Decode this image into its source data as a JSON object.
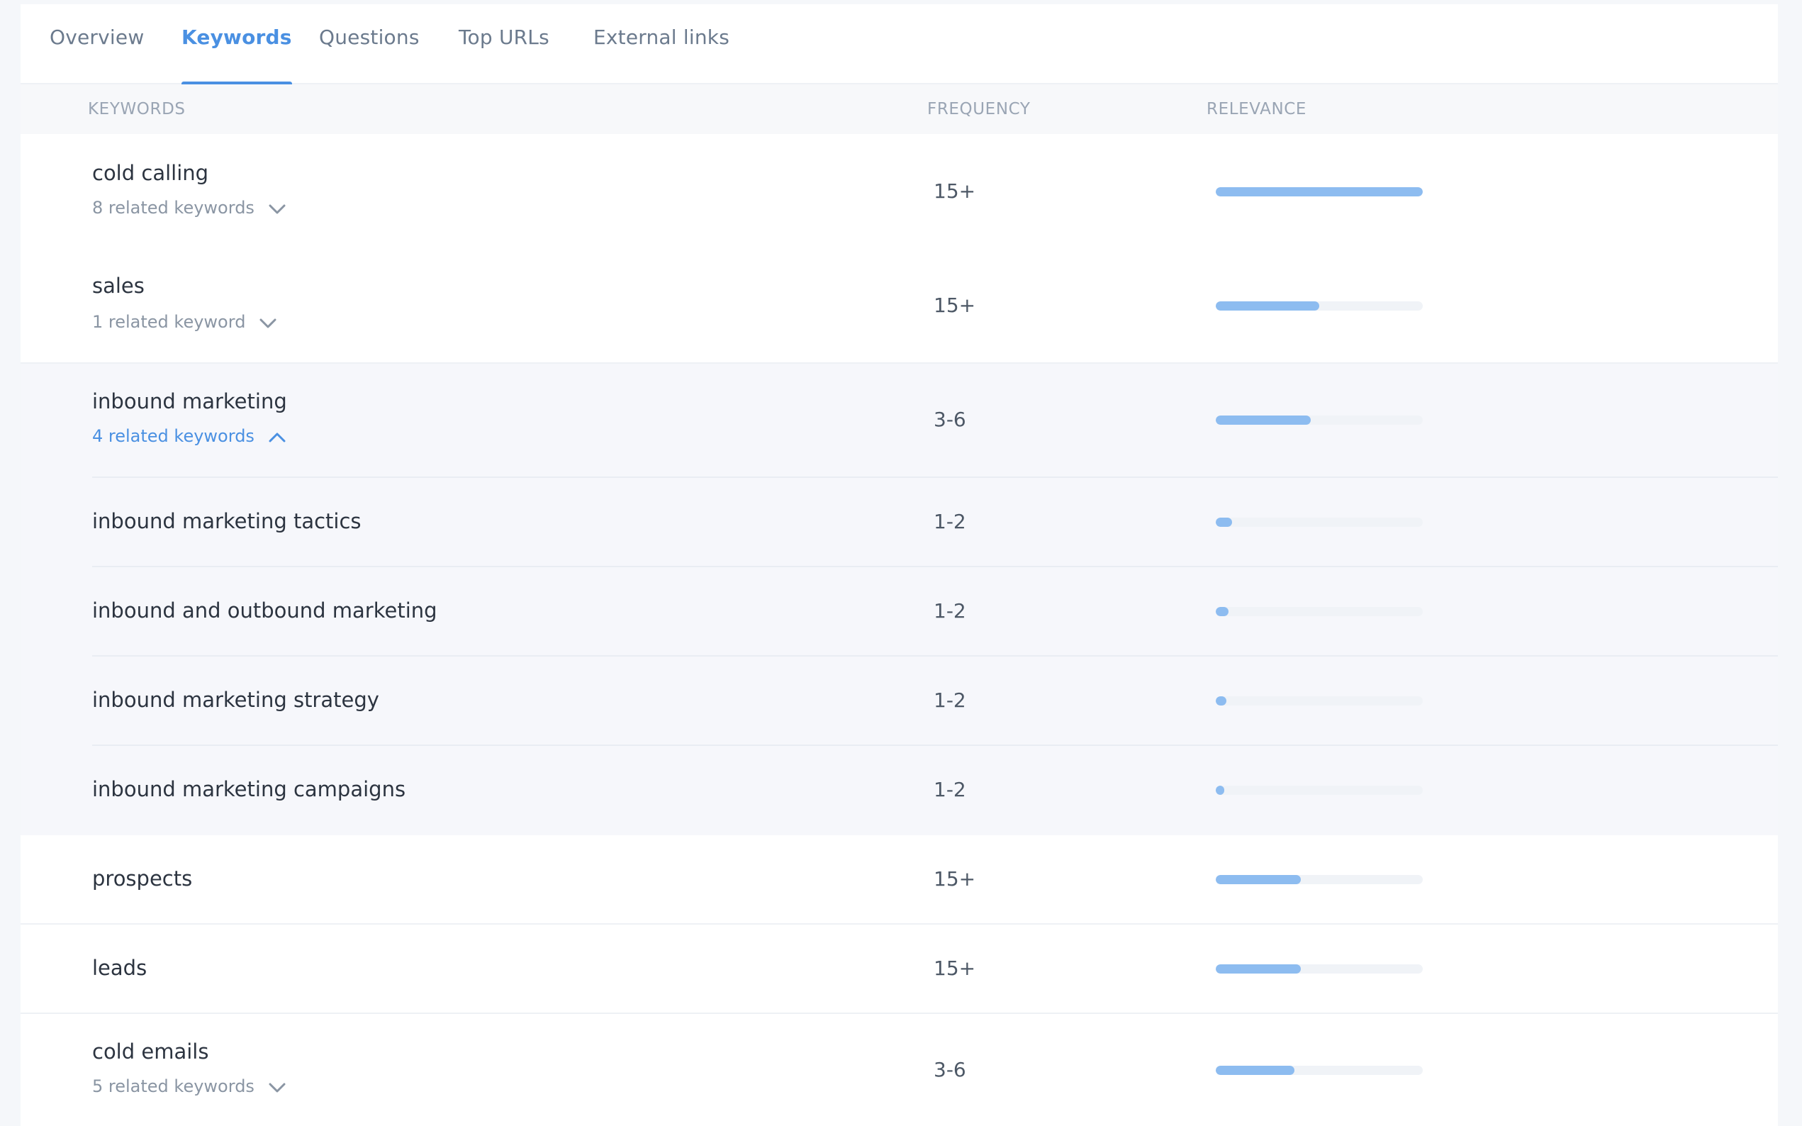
{
  "tabs": [
    {
      "label": "Overview",
      "active": false
    },
    {
      "label": "Keywords",
      "active": true
    },
    {
      "label": "Questions",
      "active": false
    },
    {
      "label": "Top URLs",
      "active": false
    },
    {
      "label": "External links",
      "active": false
    }
  ],
  "table": {
    "headers": {
      "keywords": "KEYWORDS",
      "frequency": "FREQUENCY",
      "relevance": "RELEVANCE"
    },
    "rows": [
      {
        "keyword": "cold calling",
        "related": "8 related keywords",
        "frequency": "15+",
        "relevance": 1.0
      },
      {
        "keyword": "sales",
        "related": "1 related keyword",
        "frequency": "15+",
        "relevance": 0.5
      },
      {
        "keyword": "inbound marketing",
        "related": "4 related keywords",
        "frequency": "3-6",
        "relevance": 0.46
      },
      {
        "keyword": "inbound marketing tactics",
        "frequency": "1-2",
        "relevance": 0.08
      },
      {
        "keyword": "inbound and outbound marketing",
        "frequency": "1-2",
        "relevance": 0.06
      },
      {
        "keyword": "inbound marketing strategy",
        "frequency": "1-2",
        "relevance": 0.05
      },
      {
        "keyword": "inbound marketing campaigns",
        "frequency": "1-2",
        "relevance": 0.04
      },
      {
        "keyword": "prospects",
        "frequency": "15+",
        "relevance": 0.41
      },
      {
        "keyword": "leads",
        "frequency": "15+",
        "relevance": 0.41
      },
      {
        "keyword": "cold emails",
        "related": "5 related keywords",
        "frequency": "3-6",
        "relevance": 0.38
      }
    ]
  },
  "colors": {
    "accent": "#4a90e2",
    "bar_fill": "#8dbcf0",
    "bar_track": "#f0f3f7"
  }
}
